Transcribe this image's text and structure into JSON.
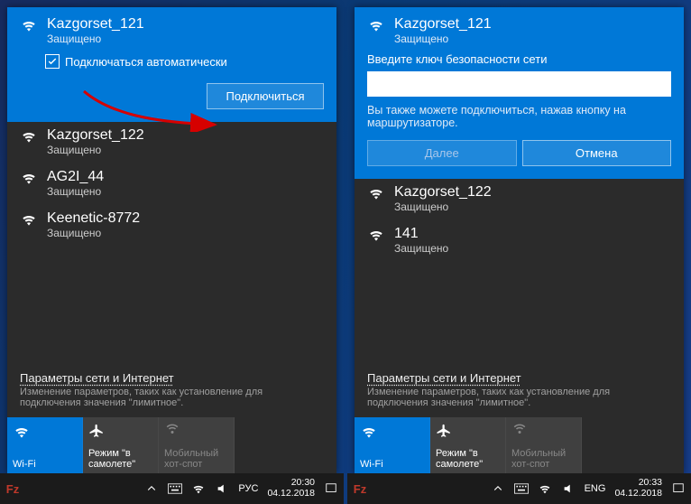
{
  "left": {
    "selected_network": {
      "name": "Kazgorset_121",
      "status": "Защищено"
    },
    "auto_connect_label": "Подключаться автоматически",
    "connect_button": "Подключиться",
    "networks": [
      {
        "name": "Kazgorset_122",
        "status": "Защищено"
      },
      {
        "name": "AG2I_44",
        "status": "Защищено"
      },
      {
        "name": "Keenetic-8772",
        "status": "Защищено"
      }
    ],
    "taskbar": {
      "lang": "РУС",
      "time": "20:30",
      "date": "04.12.2018"
    }
  },
  "right": {
    "selected_network": {
      "name": "Kazgorset_121",
      "status": "Защищено"
    },
    "prompt": "Введите ключ безопасности сети",
    "key_value": "",
    "hint": "Вы также можете подключиться, нажав кнопку на маршрутизаторе.",
    "next_button": "Далее",
    "cancel_button": "Отмена",
    "networks": [
      {
        "name": "Kazgorset_122",
        "status": "Защищено"
      },
      {
        "name": "141",
        "status": "Защищено"
      }
    ],
    "taskbar": {
      "lang": "ENG",
      "time": "20:33",
      "date": "04.12.2018"
    }
  },
  "settings": {
    "link": "Параметры сети и Интернет",
    "sub": "Изменение параметров, таких как установление для подключения значения \"лимитное\"."
  },
  "tiles": {
    "wifi": "Wi-Fi",
    "airplane": "Режим \"в самолете\"",
    "hotspot": "Мобильный хот-спот"
  }
}
